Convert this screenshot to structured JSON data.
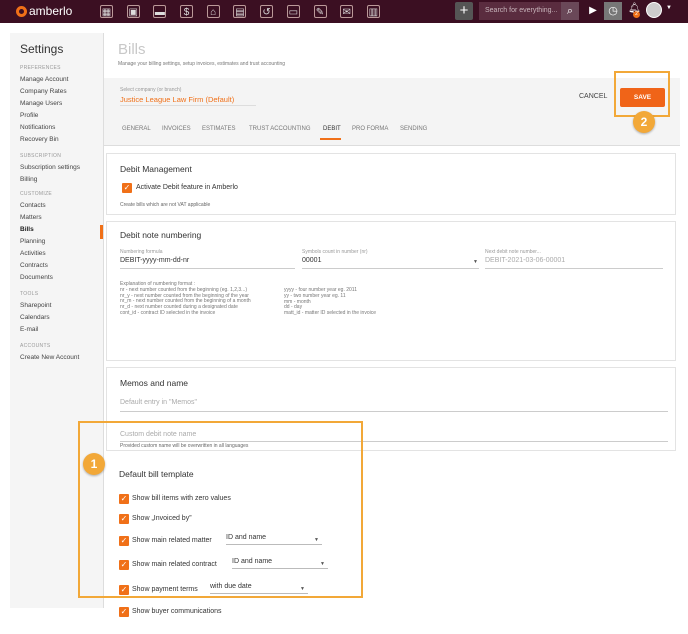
{
  "topbar": {
    "brand": "amberlo",
    "search_placeholder": "Search for everything...",
    "plus_label": "+",
    "notifications_count": "2",
    "nav_icons": [
      "dashboard-icon",
      "contacts-icon",
      "briefcase-icon",
      "document-icon",
      "bank-icon",
      "calendar-icon",
      "timer-history-icon",
      "folder-icon",
      "checklist-icon",
      "mail-icon",
      "reports-icon"
    ]
  },
  "sidebar": {
    "title": "Settings",
    "sections": [
      {
        "label": "PREFERENCES",
        "items": [
          "Manage Account",
          "Company Rates",
          "Manage Users",
          "Profile",
          "Notifications",
          "Recovery Bin"
        ]
      },
      {
        "label": "SUBSCRIPTION",
        "items": [
          "Subscription settings",
          "Billing"
        ]
      },
      {
        "label": "CUSTOMIZE",
        "items": [
          "Contacts",
          "Matters",
          "Bills",
          "Planning",
          "Activities",
          "Contracts",
          "Documents"
        ]
      },
      {
        "label": "TOOLS",
        "items": [
          "Sharepoint",
          "Calendars",
          "E-mail"
        ]
      },
      {
        "label": "ACCOUNTS",
        "items": [
          "Create New Account"
        ]
      }
    ],
    "active_item": "Bills"
  },
  "page": {
    "title": "Bills",
    "description": "Manage your billing settings, setup invoices, estimates and trust accounting"
  },
  "company": {
    "label": "Select company (or branch)",
    "value": "Justice League Law Firm (Default)"
  },
  "actions": {
    "cancel": "CANCEL",
    "save": "SAVE"
  },
  "tabs": [
    "GENERAL",
    "INVOICES",
    "ESTIMATES",
    "TRUST ACCOUNTING",
    "DEBIT",
    "PRO FORMA",
    "SENDING"
  ],
  "active_tab": "DEBIT",
  "debit_management": {
    "heading": "Debit Management",
    "checkbox_label": "Activate Debit feature in Amberlo",
    "note": "Create bills which are not VAT applicable"
  },
  "debit_numbering": {
    "heading": "Debit note numbering",
    "formula_label": "Numbering formula",
    "formula_value": "DEBIT-yyyy-mm-dd-nr",
    "symbols_label": "Symbols count in number (nr)",
    "symbols_value": "00001",
    "next_label": "Next debit note number...",
    "next_value": "DEBIT-2021-03-06-00001",
    "explanation_left": [
      "Explanation of numbering format :",
      "nr - next number counted from the beginning (eg. 1,2,3...)",
      "nr_y - next number counted from the beginning of the year",
      "nr_m - next number counted from the beginning of a month",
      "nr_d - next number counted during a designated date",
      "cont_id - contract ID selected in the invoice"
    ],
    "explanation_right": [
      "yyyy - four number year eg. 2011",
      "yy - two number year eg. 11",
      "mm - month",
      "dd - day",
      "matt_id - matter ID selected in the invoice"
    ]
  },
  "memos": {
    "heading": "Memos and name",
    "memos_placeholder": "Default entry in \"Memos\"",
    "name_placeholder": "Custom debit note name",
    "name_note": "Provided custom name will be overwritten in all languages"
  },
  "template": {
    "heading": "Default bill template",
    "zero_values": "Show bill items with zero values",
    "invoiced_by": "Show „Invoiced by”",
    "matter_label": "Show main related matter",
    "matter_value": "ID and name",
    "contract_label": "Show main related contract",
    "contract_value": "ID and name",
    "payment_label": "Show payment terms",
    "payment_value": "with due date",
    "buyer_comms": "Show buyer communications"
  },
  "callouts": {
    "one": "1",
    "two": "2"
  },
  "colors": {
    "accent": "#f07018",
    "highlight": "#f2a838",
    "topbar": "#3b0f22"
  }
}
